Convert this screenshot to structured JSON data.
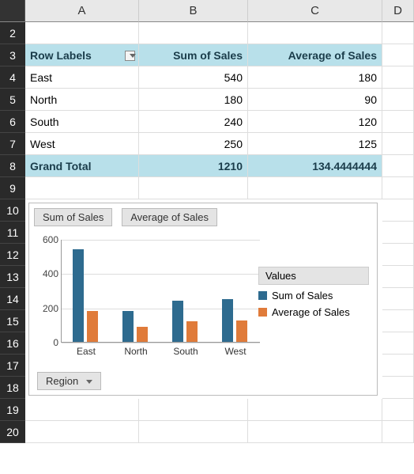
{
  "columns": [
    "A",
    "B",
    "C",
    "D"
  ],
  "rows_shown": [
    "2",
    "3",
    "4",
    "5",
    "6",
    "7",
    "8",
    "9",
    "10",
    "11",
    "12",
    "13",
    "14",
    "15",
    "16",
    "17",
    "18",
    "19",
    "20"
  ],
  "pivot": {
    "row_label_header": "Row Labels",
    "col1_header": "Sum of Sales",
    "col2_header": "Average of Sales",
    "rows": [
      {
        "label": "East",
        "sum": "540",
        "avg": "180"
      },
      {
        "label": "North",
        "sum": "180",
        "avg": "90"
      },
      {
        "label": "South",
        "sum": "240",
        "avg": "120"
      },
      {
        "label": "West",
        "sum": "250",
        "avg": "125"
      }
    ],
    "grand_label": "Grand Total",
    "grand_sum": "1210",
    "grand_avg": "134.4444444"
  },
  "chart": {
    "field_buttons": [
      "Sum of Sales",
      "Average of Sales"
    ],
    "legend_title": "Values",
    "legend_items": [
      "Sum of Sales",
      "Average of Sales"
    ],
    "region_btn": "Region",
    "colors": {
      "s0": "#2e6b8f",
      "s1": "#e07b3a"
    }
  },
  "chart_data": {
    "type": "bar",
    "categories": [
      "East",
      "North",
      "South",
      "West"
    ],
    "series": [
      {
        "name": "Sum of Sales",
        "values": [
          540,
          180,
          240,
          250
        ]
      },
      {
        "name": "Average of Sales",
        "values": [
          180,
          90,
          120,
          125
        ]
      }
    ],
    "ylim": [
      0,
      600
    ],
    "yticks": [
      0,
      200,
      400,
      600
    ],
    "xlabel": "",
    "ylabel": "",
    "title": ""
  }
}
